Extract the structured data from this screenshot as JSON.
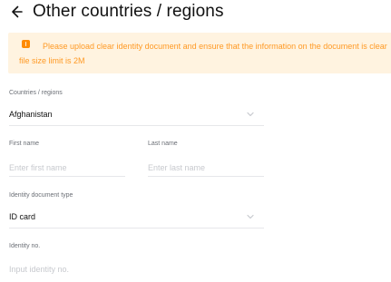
{
  "header": {
    "back_icon": "arrow-left-icon",
    "title": "Other countries / regions"
  },
  "notice": {
    "icon": "warning-icon",
    "text_line1": "Please upload clear identity document and ensure that the information on the document is clear",
    "text_line2": "file size limit is 2M",
    "colors": {
      "background": "#fff3e0",
      "text": "#ff9a25",
      "icon": "#ff8a00"
    }
  },
  "form": {
    "country": {
      "label": "Countries / regions",
      "value": "Afghanistan",
      "icon": "chevron-down-icon"
    },
    "first_name": {
      "label": "First name",
      "placeholder": "Enter first name"
    },
    "last_name": {
      "label": "Last name",
      "placeholder": "Enter last name"
    },
    "id_type": {
      "label": "Identity document type",
      "value": "ID card",
      "icon": "chevron-down-icon"
    },
    "id_no": {
      "label": "Identity no.",
      "placeholder": "Input identity no."
    }
  }
}
